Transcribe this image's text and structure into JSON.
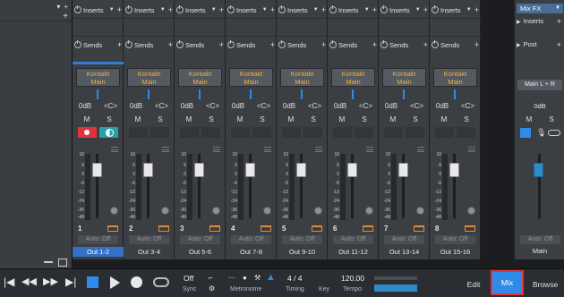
{
  "left_panel": {
    "collapse_arrow": "▾",
    "add": "+"
  },
  "channels": [
    {
      "insert_label": "Inserts",
      "sends_label": "Sends",
      "instrument": "Kontakt",
      "instrument_sub": "Main",
      "volume": "0dB",
      "pan": "<C>",
      "mute": "M",
      "solo": "S",
      "number": "1",
      "automation": "Auto: Off",
      "output": "Out 1-2",
      "selected": true,
      "armed": true
    },
    {
      "insert_label": "Inserts",
      "sends_label": "Sends",
      "instrument": "Kontakt",
      "instrument_sub": "Main",
      "volume": "0dB",
      "pan": "<C>",
      "mute": "M",
      "solo": "S",
      "number": "2",
      "automation": "Auto: Off",
      "output": "Out 3-4"
    },
    {
      "insert_label": "Inserts",
      "sends_label": "Sends",
      "instrument": "Kontakt",
      "instrument_sub": "Main",
      "volume": "0dB",
      "pan": "<C>",
      "mute": "M",
      "solo": "S",
      "number": "3",
      "automation": "Auto: Off",
      "output": "Out 5-6"
    },
    {
      "insert_label": "Inserts",
      "sends_label": "Sends",
      "instrument": "Kontakt",
      "instrument_sub": "Main",
      "volume": "0dB",
      "pan": "<C>",
      "mute": "M",
      "solo": "S",
      "number": "4",
      "automation": "Auto: Off",
      "output": "Out 7-8"
    },
    {
      "insert_label": "Inserts",
      "sends_label": "Sends",
      "instrument": "Kontakt",
      "instrument_sub": "Main",
      "volume": "0dB",
      "pan": "<C>",
      "mute": "M",
      "solo": "S",
      "number": "5",
      "automation": "Auto: Off",
      "output": "Out 9-10"
    },
    {
      "insert_label": "Inserts",
      "sends_label": "Sends",
      "instrument": "Kontakt",
      "instrument_sub": "Main",
      "volume": "0dB",
      "pan": "<C>",
      "mute": "M",
      "solo": "S",
      "number": "6",
      "automation": "Auto: Off",
      "output": "Out 11-12"
    },
    {
      "insert_label": "Inserts",
      "sends_label": "Sends",
      "instrument": "Kontakt",
      "instrument_sub": "Main",
      "volume": "0dB",
      "pan": "<C>",
      "mute": "M",
      "solo": "S",
      "number": "7",
      "automation": "Auto: Off",
      "output": "Out 13-14"
    },
    {
      "insert_label": "Inserts",
      "sends_label": "Sends",
      "instrument": "Kontakt",
      "instrument_sub": "Main",
      "volume": "0dB",
      "pan": "<C>",
      "mute": "M",
      "solo": "S",
      "number": "8",
      "automation": "Auto: Off",
      "output": "Out 15-16"
    }
  ],
  "fader_scale": [
    "10",
    "6",
    "0",
    "-6",
    "-12",
    "-24",
    "-36",
    "-48"
  ],
  "main_bus": {
    "mixfx": "Mix FX",
    "inserts": "Inserts",
    "post": "Post",
    "routing": "Main L + R",
    "volume": "0dB",
    "mute": "M",
    "solo": "S",
    "automation": "Auto: Off",
    "name": "Main"
  },
  "transport": {
    "sync_value": "Off",
    "sync_label": "Sync",
    "metronome_label": "Metronome",
    "timing_value": "4 / 4",
    "timing_label": "Timing",
    "key_value": "",
    "key_label": "Key",
    "tempo_value": "120.00",
    "tempo_label": "Tempo",
    "edit": "Edit",
    "mix": "Mix",
    "browse": "Browse"
  },
  "colors": {
    "accent": "#2f8bea",
    "record": "#e0333b",
    "monitor": "#2b9fa9",
    "instrument_text": "#f0b13c",
    "selected_output": "#3470c4"
  }
}
